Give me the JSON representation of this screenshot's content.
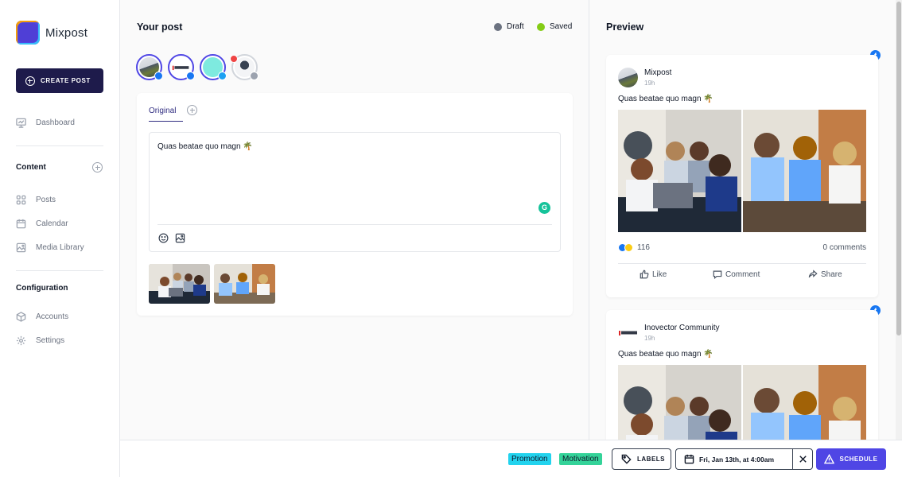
{
  "app": {
    "name": "Mixpost"
  },
  "sidebar": {
    "create_post": "CREATE POST",
    "dashboard": "Dashboard",
    "content_title": "Content",
    "content_items": [
      "Posts",
      "Calendar",
      "Media Library"
    ],
    "configuration_title": "Configuration",
    "configuration_items": [
      "Accounts",
      "Settings"
    ]
  },
  "post": {
    "title": "Your post",
    "status": [
      {
        "label": "Draft",
        "color": "#6b7280"
      },
      {
        "label": "Saved",
        "color": "#84cc16"
      }
    ],
    "accounts": [
      {
        "name": "mixpost-avatar",
        "network": "facebook",
        "selected": true
      },
      {
        "name": "inovector-avatar",
        "network": "facebook",
        "selected": true
      },
      {
        "name": "teal-avatar",
        "network": "twitter",
        "selected": true
      },
      {
        "name": "person-avatar",
        "network": "mastodon",
        "selected": false,
        "error": true
      }
    ],
    "tab_original": "Original",
    "body": "Quas beatae quo magn 🌴"
  },
  "preview": {
    "title": "Preview",
    "cards": [
      {
        "name": "Mixpost",
        "time": "19h",
        "text": "Quas beatae quo magn 🌴",
        "reactions": "116",
        "comments": "0 comments"
      },
      {
        "name": "Inovector Community",
        "time": "19h",
        "text": "Quas beatae quo magn 🌴"
      }
    ],
    "actions": {
      "like": "Like",
      "comment": "Comment",
      "share": "Share"
    }
  },
  "bottom": {
    "labels": [
      {
        "text": "Promotion",
        "color": "#22d3ee"
      },
      {
        "text": "Motivation",
        "color": "#34d399"
      }
    ],
    "labels_button": "LABELS",
    "date": "Fri, Jan 13th, at 4:00am",
    "schedule": "SCHEDULE"
  },
  "colors": {
    "primary": "#4f46e5",
    "dark": "#1e1b4b",
    "facebook": "#1877f2"
  }
}
